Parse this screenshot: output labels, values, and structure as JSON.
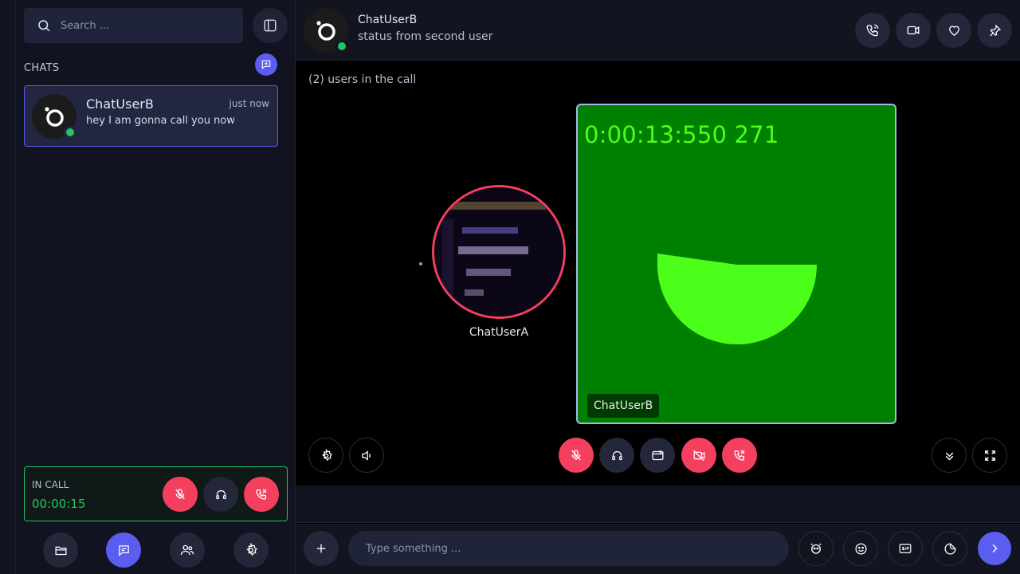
{
  "search": {
    "placeholder": "Search ..."
  },
  "sidebar": {
    "section_label": "CHATS",
    "chats": [
      {
        "name": "ChatUserB",
        "time": "just now",
        "last_message": "hey I am gonna call you now",
        "online": true
      }
    ],
    "in_call": {
      "label": "IN CALL",
      "duration": "00:00:15"
    },
    "nav": [
      "folder-icon",
      "chat-icon",
      "users-icon",
      "settings-icon"
    ]
  },
  "header": {
    "name": "ChatUserB",
    "status": "status from second user"
  },
  "call": {
    "users_count": "(2) users in the call",
    "participants": [
      {
        "name": "ChatUserA"
      },
      {
        "name": "ChatUserB",
        "video_timer": "0:00:13:550 271"
      }
    ]
  },
  "composer": {
    "placeholder": "Type something ..."
  },
  "colors": {
    "accent": "#5b5cf0",
    "danger": "#f43f5e",
    "online": "#22c55e"
  }
}
